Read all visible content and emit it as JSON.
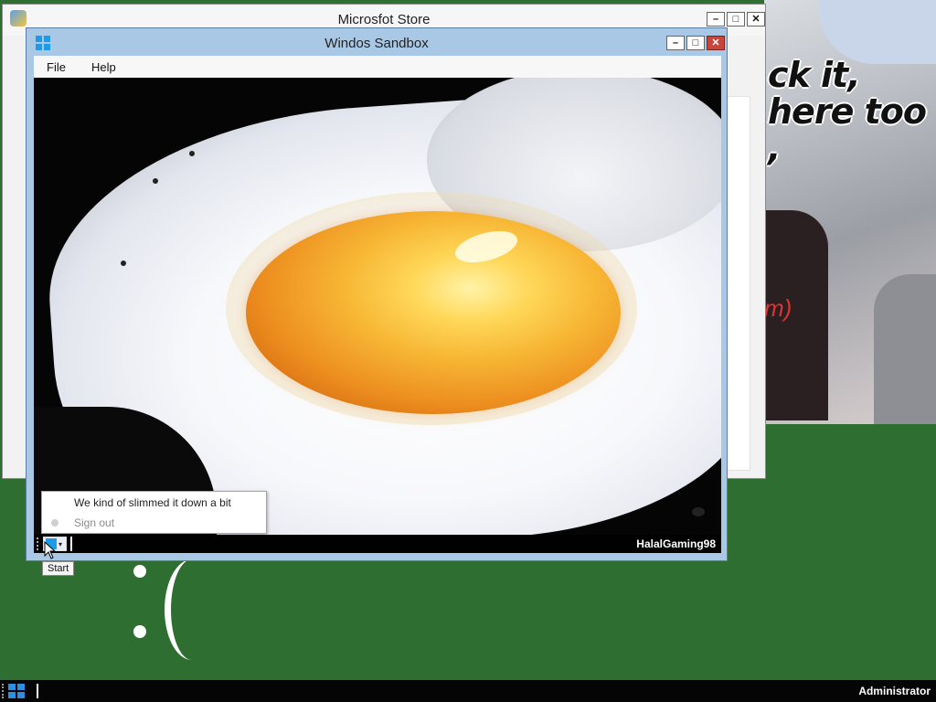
{
  "store_window": {
    "title": "Microsfot Store"
  },
  "sandbox_window": {
    "title": "Windos Sandbox",
    "menu": [
      "File",
      "Help"
    ]
  },
  "vm": {
    "start_tooltip": "Start",
    "username": "HalalGaming98",
    "start_menu": {
      "items": [
        {
          "label": "We kind of slimmed it down a bit",
          "enabled": true
        },
        {
          "label": "Sign out",
          "enabled": false
        }
      ]
    }
  },
  "wallpaper": {
    "caption": "ck it, here too ,",
    "red_text": "m)"
  },
  "host_taskbar": {
    "username": "Administrator"
  },
  "colors": {
    "desktop": "#2f6e31",
    "sandbox_frame": "#a9c8e6",
    "close_button": "#c7453a",
    "start_logo": "#1e9be6"
  }
}
